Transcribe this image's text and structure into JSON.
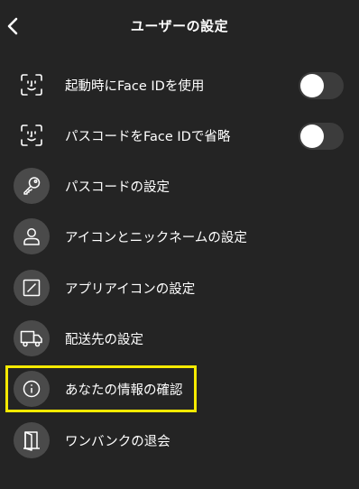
{
  "header": {
    "title": "ユーザーの設定",
    "back_icon": "chevron-left-icon"
  },
  "settings": {
    "items": [
      {
        "label": "起動時にFace IDを使用",
        "icon": "face-id-icon",
        "control": "toggle",
        "on": false
      },
      {
        "label": "パスコードをFace IDで省略",
        "icon": "face-id-icon",
        "control": "toggle",
        "on": false
      },
      {
        "label": "パスコードの設定",
        "icon": "key-icon"
      },
      {
        "label": "アイコンとニックネームの設定",
        "icon": "person-icon"
      },
      {
        "label": "アプリアイコンの設定",
        "icon": "app-icon-icon"
      },
      {
        "label": "配送先の設定",
        "icon": "truck-icon"
      },
      {
        "label": "あなたの情報の確認",
        "icon": "info-icon",
        "highlighted": true
      },
      {
        "label": "ワンバンクの退会",
        "icon": "door-exit-icon"
      }
    ]
  },
  "colors": {
    "background": "#242424",
    "icon_circle": "#4a4a4a",
    "toggle_track_off": "#3c3c3c",
    "highlight": "#f5ea00",
    "text": "#ffffff"
  }
}
